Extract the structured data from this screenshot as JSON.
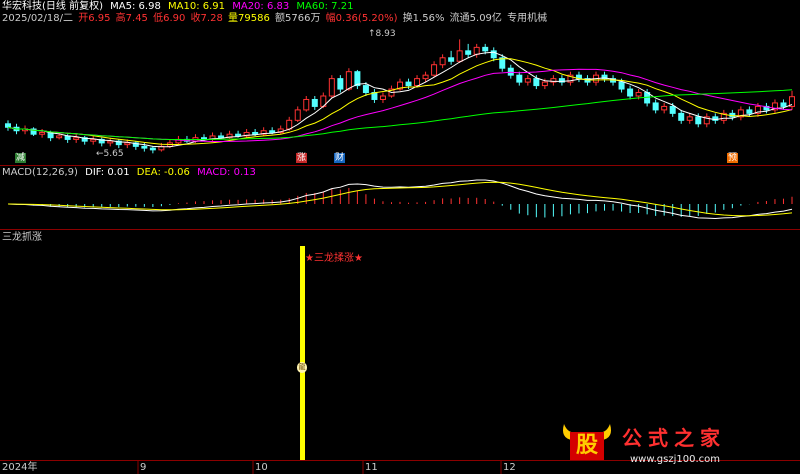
{
  "header": {
    "stock": "华宏科技(日线 前复权)",
    "ma5": "MA5: 6.98",
    "ma10": "MA10: 6.91",
    "ma20": "MA20: 6.83",
    "ma60": "MA60: 7.21",
    "date": "2025/02/18/二",
    "open": "开6.95",
    "high": "高7.45",
    "low": "低6.90",
    "close": "收7.28",
    "volume": "量79586",
    "amount": "额5766万",
    "change": "幅0.36(5.20%)",
    "turnover": "换1.56%",
    "float_cap": "流通5.09亿",
    "concept": "专用机械",
    "hi_mark": "8.93",
    "lo_mark": "5.65"
  },
  "markers": [
    {
      "label": "减",
      "color": "#2e7d32"
    },
    {
      "label": "涨",
      "color": "#c62828"
    },
    {
      "label": "财",
      "color": "#1565c0"
    },
    {
      "label": "预",
      "color": "#ef6c00"
    }
  ],
  "macd": {
    "label": "MACD(12,26,9)",
    "dif": "DIF: 0.01",
    "dea": "DEA: -0.06",
    "macd": "MACD: 0.13"
  },
  "indicator": {
    "label": "三龙抓涨",
    "signal": "★三龙揉涨★",
    "signal_glyph": "龍"
  },
  "xaxis": [
    "2024年",
    "9",
    "10",
    "11",
    "12"
  ],
  "watermark": {
    "logo": "股",
    "name": "公式之家",
    "url": "www.gszj100.com"
  },
  "colors": {
    "ma5": "#ffffff",
    "ma10": "#ffff00",
    "ma20": "#ff00ff",
    "ma60": "#00ff00",
    "up": "#ff3232",
    "down": "#54ffff",
    "signal": "#ffff00"
  },
  "chart_data": {
    "type": "candlestick",
    "price_range": [
      5.4,
      9.2
    ],
    "candles": [
      [
        6.5,
        6.4,
        6.6,
        6.3
      ],
      [
        6.4,
        6.3,
        6.5,
        6.2
      ],
      [
        6.3,
        6.35,
        6.45,
        6.2
      ],
      [
        6.35,
        6.2,
        6.4,
        6.15
      ],
      [
        6.2,
        6.25,
        6.35,
        6.1
      ],
      [
        6.25,
        6.1,
        6.3,
        6.0
      ],
      [
        6.1,
        6.15,
        6.25,
        6.05
      ],
      [
        6.15,
        6.05,
        6.2,
        5.95
      ],
      [
        6.05,
        6.1,
        6.2,
        5.95
      ],
      [
        6.1,
        6.0,
        6.15,
        5.9
      ],
      [
        6.0,
        6.05,
        6.15,
        5.9
      ],
      [
        6.05,
        5.95,
        6.1,
        5.85
      ],
      [
        5.95,
        6.0,
        6.1,
        5.85
      ],
      [
        6.0,
        5.9,
        6.05,
        5.8
      ],
      [
        5.9,
        5.95,
        6.05,
        5.8
      ],
      [
        5.95,
        5.85,
        6.0,
        5.75
      ],
      [
        5.85,
        5.8,
        5.95,
        5.7
      ],
      [
        5.8,
        5.75,
        5.85,
        5.65
      ],
      [
        5.75,
        5.85,
        5.95,
        5.7
      ],
      [
        5.85,
        5.95,
        6.05,
        5.8
      ],
      [
        5.95,
        6.05,
        6.15,
        5.9
      ],
      [
        6.05,
        6.0,
        6.15,
        5.95
      ],
      [
        6.0,
        6.1,
        6.2,
        5.95
      ],
      [
        6.1,
        6.05,
        6.2,
        6.0
      ],
      [
        6.05,
        6.15,
        6.25,
        6.0
      ],
      [
        6.15,
        6.1,
        6.25,
        6.05
      ],
      [
        6.1,
        6.2,
        6.3,
        6.05
      ],
      [
        6.2,
        6.15,
        6.3,
        6.1
      ],
      [
        6.15,
        6.25,
        6.35,
        6.1
      ],
      [
        6.25,
        6.2,
        6.35,
        6.15
      ],
      [
        6.2,
        6.3,
        6.4,
        6.15
      ],
      [
        6.3,
        6.25,
        6.4,
        6.2
      ],
      [
        6.25,
        6.35,
        6.45,
        6.2
      ],
      [
        6.35,
        6.6,
        6.7,
        6.3
      ],
      [
        6.6,
        6.9,
        7.0,
        6.55
      ],
      [
        6.9,
        7.2,
        7.3,
        6.85
      ],
      [
        7.2,
        7.0,
        7.3,
        6.9
      ],
      [
        7.0,
        7.3,
        7.4,
        6.95
      ],
      [
        7.3,
        7.8,
        7.9,
        7.25
      ],
      [
        7.8,
        7.5,
        7.9,
        7.4
      ],
      [
        7.5,
        8.0,
        8.1,
        7.45
      ],
      [
        8.0,
        7.6,
        8.05,
        7.5
      ],
      [
        7.6,
        7.4,
        7.7,
        7.3
      ],
      [
        7.4,
        7.2,
        7.5,
        7.1
      ],
      [
        7.2,
        7.3,
        7.4,
        7.1
      ],
      [
        7.3,
        7.5,
        7.6,
        7.25
      ],
      [
        7.5,
        7.7,
        7.8,
        7.45
      ],
      [
        7.7,
        7.6,
        7.8,
        7.5
      ],
      [
        7.6,
        7.8,
        7.9,
        7.55
      ],
      [
        7.8,
        7.9,
        8.0,
        7.7
      ],
      [
        7.9,
        8.2,
        8.3,
        7.85
      ],
      [
        8.2,
        8.4,
        8.5,
        8.1
      ],
      [
        8.4,
        8.3,
        8.6,
        8.2
      ],
      [
        8.3,
        8.6,
        8.93,
        8.25
      ],
      [
        8.6,
        8.5,
        8.8,
        8.4
      ],
      [
        8.5,
        8.7,
        8.8,
        8.4
      ],
      [
        8.7,
        8.6,
        8.8,
        8.5
      ],
      [
        8.6,
        8.4,
        8.7,
        8.3
      ],
      [
        8.4,
        8.1,
        8.5,
        8.0
      ],
      [
        8.1,
        7.9,
        8.2,
        7.8
      ],
      [
        7.9,
        7.7,
        8.0,
        7.6
      ],
      [
        7.7,
        7.8,
        7.9,
        7.6
      ],
      [
        7.8,
        7.6,
        7.9,
        7.5
      ],
      [
        7.6,
        7.7,
        7.8,
        7.5
      ],
      [
        7.7,
        7.8,
        7.9,
        7.6
      ],
      [
        7.8,
        7.7,
        7.9,
        7.6
      ],
      [
        7.7,
        7.9,
        8.0,
        7.6
      ],
      [
        7.9,
        7.8,
        8.0,
        7.7
      ],
      [
        7.8,
        7.7,
        7.9,
        7.6
      ],
      [
        7.7,
        7.9,
        8.0,
        7.6
      ],
      [
        7.9,
        7.8,
        8.0,
        7.7
      ],
      [
        7.8,
        7.7,
        7.9,
        7.6
      ],
      [
        7.7,
        7.5,
        7.8,
        7.4
      ],
      [
        7.5,
        7.3,
        7.6,
        7.2
      ],
      [
        7.3,
        7.4,
        7.5,
        7.2
      ],
      [
        7.4,
        7.1,
        7.5,
        7.0
      ],
      [
        7.1,
        6.9,
        7.2,
        6.8
      ],
      [
        6.9,
        7.0,
        7.1,
        6.8
      ],
      [
        7.0,
        6.8,
        7.1,
        6.7
      ],
      [
        6.8,
        6.6,
        6.9,
        6.5
      ],
      [
        6.6,
        6.7,
        6.8,
        6.5
      ],
      [
        6.7,
        6.5,
        6.8,
        6.4
      ],
      [
        6.5,
        6.7,
        6.8,
        6.4
      ],
      [
        6.7,
        6.6,
        6.8,
        6.5
      ],
      [
        6.6,
        6.8,
        6.9,
        6.5
      ],
      [
        6.8,
        6.7,
        6.9,
        6.6
      ],
      [
        6.7,
        6.9,
        7.0,
        6.6
      ],
      [
        6.9,
        6.8,
        7.0,
        6.7
      ],
      [
        6.8,
        7.0,
        7.1,
        6.7
      ],
      [
        7.0,
        6.9,
        7.1,
        6.8
      ],
      [
        6.9,
        7.1,
        7.2,
        6.8
      ],
      [
        7.1,
        7.0,
        7.2,
        6.9
      ],
      [
        7.0,
        7.28,
        7.45,
        6.9
      ]
    ]
  }
}
